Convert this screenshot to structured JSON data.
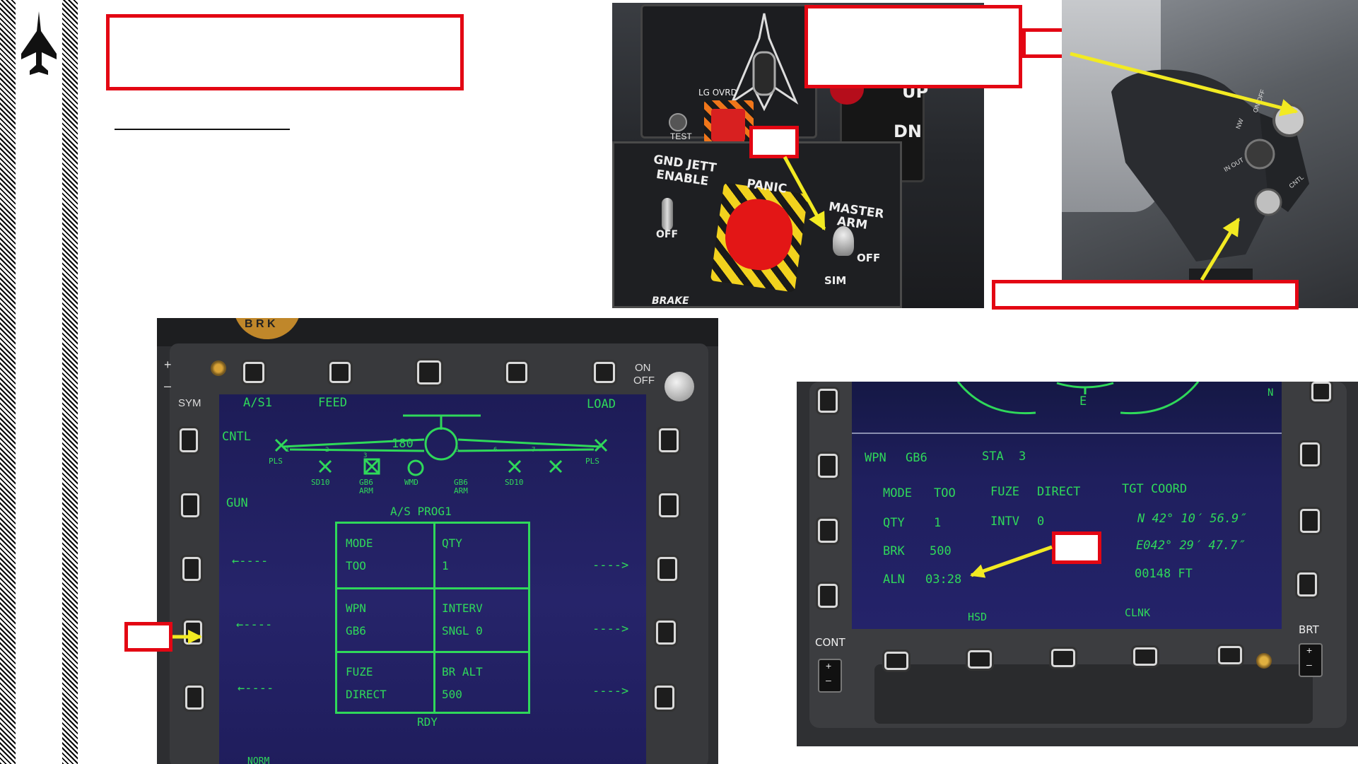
{
  "colors": {
    "accent_red": "#e30613",
    "arrow_yellow": "#f2ea22",
    "display_green": "#2fd85a",
    "screen_blue": "#23216a"
  },
  "cockpit_panel": {
    "lg_ovrd": "LG OVRD",
    "test": "TEST",
    "up": "UP",
    "dn": "DN",
    "gnd_jett": "GND  JETT",
    "enable": "ENABLE",
    "off_left": "OFF",
    "panic": "PANIC",
    "master": "MASTER",
    "arm": "ARM",
    "off_right": "OFF",
    "sim": "SIM",
    "brake": "BRAKE"
  },
  "stick": {
    "mark1": "ON/OFF",
    "mark2": "IN OUT",
    "mark3": "CNTL",
    "mark4": "NW"
  },
  "left_mfd": {
    "top_left_text": "+",
    "top_left_minus": "–",
    "on": "ON",
    "off": "OFF",
    "sym": "SYM",
    "header_a": "A/S1",
    "header_b": "FEED",
    "header_c": "LOAD",
    "cntl": "CNTL",
    "gun": "GUN",
    "heading": "180",
    "stations": [
      {
        "num": "1",
        "name": "PLS"
      },
      {
        "num": "2",
        "name": "SD10"
      },
      {
        "num": "3",
        "name": "GB6",
        "sub": "ARM"
      },
      {
        "num": "",
        "name": "WMD"
      },
      {
        "num": "5",
        "name": "GB6",
        "sub": "ARM"
      },
      {
        "num": "6",
        "name": "SD10"
      },
      {
        "num": "7",
        "name": "PLS"
      }
    ],
    "prog_title": "A/S PROG1",
    "cells": [
      {
        "label": "MODE",
        "value": "TOO"
      },
      {
        "label": "QTY",
        "value": "1"
      },
      {
        "label": "WPN",
        "value": "GB6"
      },
      {
        "label": "INTERV",
        "value": "SNGL      0"
      },
      {
        "label": "FUZE",
        "value": "DIRECT"
      },
      {
        "label": "BR ALT",
        "value": " 500"
      }
    ],
    "arrow_left": "←----",
    "arrow_right": "---->",
    "rdy": "RDY",
    "norm": "NORM",
    "brk_logo": "B R K"
  },
  "right_mfd": {
    "compass": "E",
    "compass_n": "N",
    "wpn_label": "WPN",
    "wpn_value": "GB6",
    "sta_label": "STA",
    "sta_value": "3",
    "mode_label": "MODE",
    "mode_value": "TOO",
    "fuze_label": "FUZE",
    "fuze_value": "DIRECT",
    "tgt_label": "TGT COORD",
    "qty_label": "QTY",
    "qty_value": "1",
    "intv_label": "INTV",
    "intv_value": "0",
    "lat": "N 42° 10′ 56.9″",
    "brk_label": "BRK",
    "brk_value": "500",
    "lon": "E042° 29′ 47.7″",
    "aln_label": "ALN",
    "aln_value": "03:28",
    "alt": "00148 FT",
    "hsd": "HSD",
    "clnk": "CLNK",
    "cont": "CONT",
    "brt": "BRT",
    "plus": "+",
    "minus": "–"
  }
}
